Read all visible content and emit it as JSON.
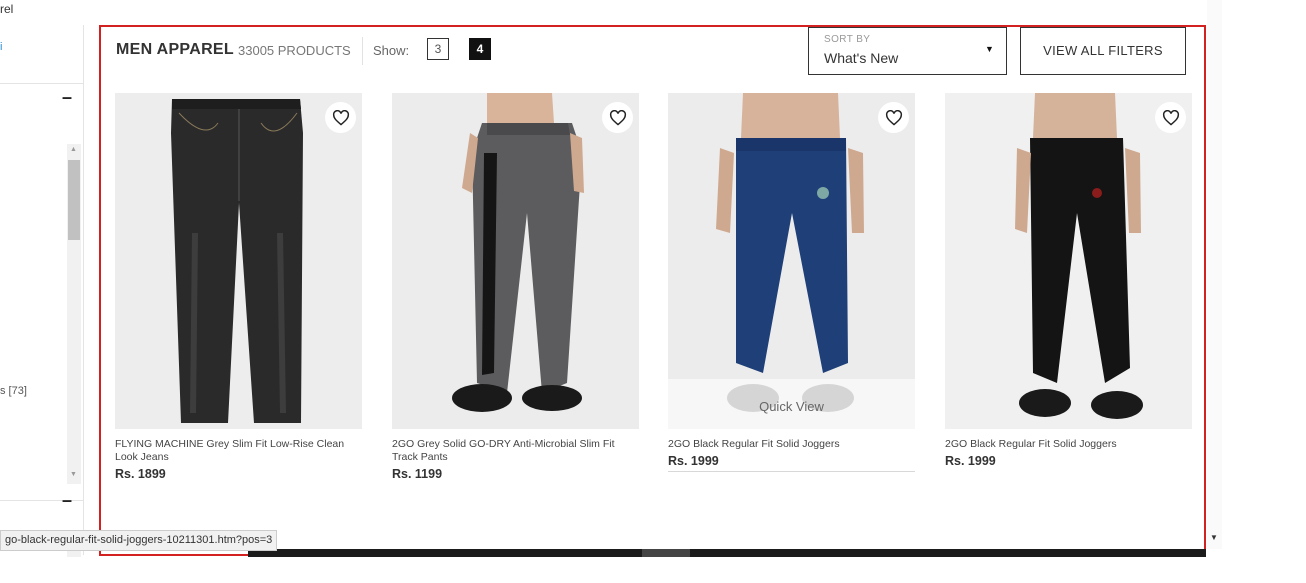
{
  "breadcrumb": "rel",
  "sidebar": {
    "top_partial": "i",
    "collapse_label": "–",
    "partial_item": "s [73]",
    "scroll_up": "▲",
    "scroll_down": "▼"
  },
  "header": {
    "title": "MEN APPAREL",
    "count": "33005 PRODUCTS",
    "show_label": "Show:",
    "grid_options": [
      "3",
      "4"
    ],
    "grid_selected": "4"
  },
  "sort": {
    "caption": "SORT BY",
    "value": "What's New",
    "caret": "▼"
  },
  "filters_button": "VIEW ALL FILTERS",
  "products": [
    {
      "name": "FLYING MACHINE Grey Slim Fit Low-Rise Clean Look Jeans",
      "price": "Rs. 1899"
    },
    {
      "name": "2GO Grey Solid GO-DRY Anti-Microbial Slim Fit Track Pants",
      "price": "Rs. 1199"
    },
    {
      "name": "2GO Black Regular Fit Solid Joggers",
      "price": "Rs. 1999",
      "overlay": "Quick View"
    },
    {
      "name": "2GO Black Regular Fit Solid Joggers",
      "price": "Rs. 1999"
    }
  ],
  "status_url": "go-black-regular-fit-solid-joggers-10211301.htm?pos=3",
  "colors": {
    "accent_border": "#d32020",
    "jeans": "#2a2a2a",
    "grey_pants": "#5c5c5e",
    "navy_pants": "#1f3f78",
    "black_pants": "#141414"
  }
}
